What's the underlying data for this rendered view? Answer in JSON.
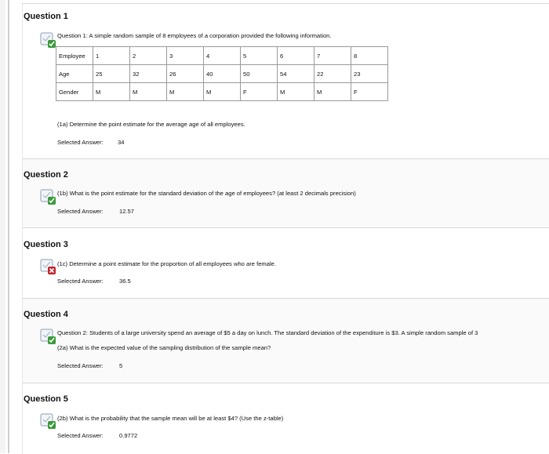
{
  "questions": [
    {
      "title": "Question 1",
      "status": "correct",
      "prompt": "Question 1: A simple random sample of 8 employees of a corporation provided the following information.",
      "table": {
        "rows": [
          [
            "Employee",
            "1",
            "2",
            "3",
            "4",
            "5",
            "6",
            "7",
            "8"
          ],
          [
            "Age",
            "25",
            "32",
            "26",
            "40",
            "50",
            "54",
            "22",
            "23"
          ],
          [
            "Gender",
            "M",
            "M",
            "M",
            "M",
            "F",
            "M",
            "M",
            "F"
          ]
        ]
      },
      "sub_prompt": "(1a) Determine the point estimate for the average age of all employees.",
      "answer_label": "Selected Answer:",
      "answer_value": "34"
    },
    {
      "title": "Question 2",
      "status": "correct",
      "prompt": "(1b) What is the point estimate for the standard deviation of the age of employees? (at least 2 decimals precision)",
      "answer_label": "Selected Answer:",
      "answer_value": "12.57"
    },
    {
      "title": "Question 3",
      "status": "incorrect",
      "prompt": "(1c) Determine a point estimate for the proportion of all employees who are female.",
      "answer_label": "Selected Answer:",
      "answer_value": "36.5"
    },
    {
      "title": "Question 4",
      "status": "correct",
      "prompt": "Question 2: Students of a large university spend an average of $5 a day on lunch. The standard deviation of the expenditure is $3. A simple random sample of 3",
      "sub_prompt": "(2a) What is the expected value of the sampling distribution of the sample mean?",
      "answer_label": "Selected Answer:",
      "answer_value": "5"
    },
    {
      "title": "Question 5",
      "status": "correct",
      "prompt": "(2b) What is the probability that the sample mean will be at least $4? (Use the z-table)",
      "answer_label": "Selected Answer:",
      "answer_value": "0.9772"
    }
  ],
  "colors": {
    "correct": "#3a9a3a",
    "incorrect": "#c0272d",
    "icon_frame": "#8aa0b8"
  }
}
